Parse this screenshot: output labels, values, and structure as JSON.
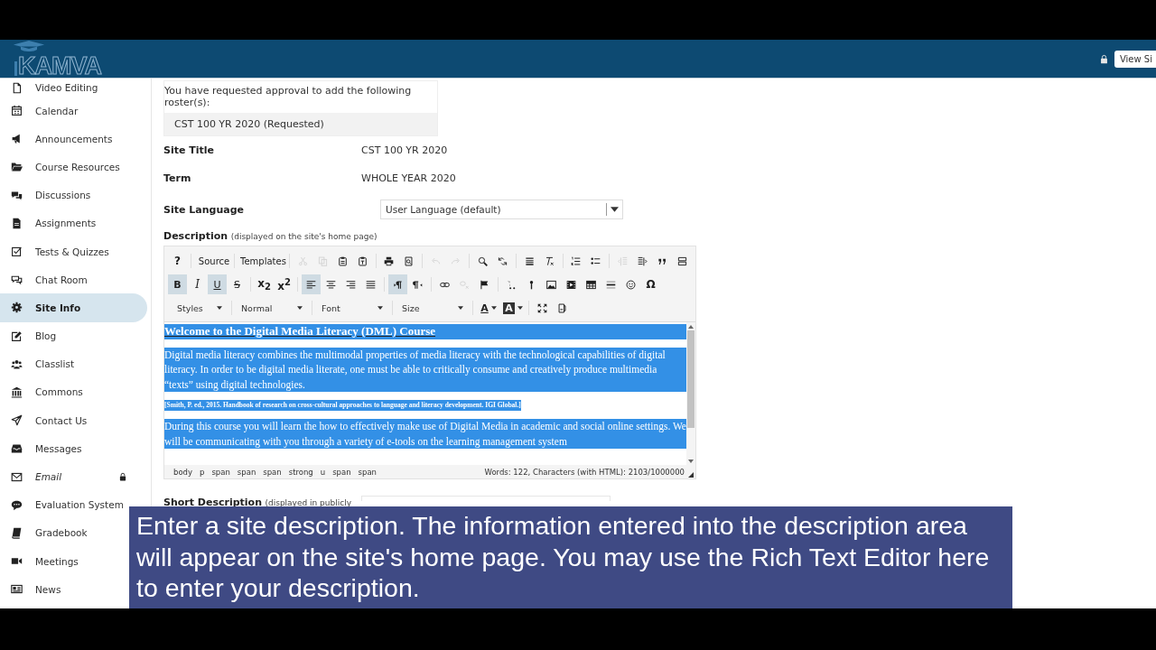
{
  "header": {
    "logo": "KAMVA",
    "view_site_button": "View Si"
  },
  "sidebar": {
    "items": [
      {
        "label": "Video Editing",
        "selected": false,
        "locked": false
      },
      {
        "label": "Calendar",
        "selected": false,
        "locked": false
      },
      {
        "label": "Announcements",
        "selected": false,
        "locked": false
      },
      {
        "label": "Course Resources",
        "selected": false,
        "locked": false
      },
      {
        "label": "Discussions",
        "selected": false,
        "locked": false
      },
      {
        "label": "Assignments",
        "selected": false,
        "locked": false
      },
      {
        "label": "Tests & Quizzes",
        "selected": false,
        "locked": false
      },
      {
        "label": "Chat Room",
        "selected": false,
        "locked": false
      },
      {
        "label": "Site Info",
        "selected": true,
        "locked": false
      },
      {
        "label": "Blog",
        "selected": false,
        "locked": false
      },
      {
        "label": "Classlist",
        "selected": false,
        "locked": false
      },
      {
        "label": "Commons",
        "selected": false,
        "locked": false
      },
      {
        "label": "Contact Us",
        "selected": false,
        "locked": false
      },
      {
        "label": "Messages",
        "selected": false,
        "locked": false
      },
      {
        "label": "Email",
        "selected": false,
        "locked": true
      },
      {
        "label": "Evaluation System",
        "selected": false,
        "locked": false
      },
      {
        "label": "Gradebook",
        "selected": false,
        "locked": false
      },
      {
        "label": "Meetings",
        "selected": false,
        "locked": false
      },
      {
        "label": "News",
        "selected": false,
        "locked": false
      }
    ]
  },
  "roster": {
    "message": "You have requested approval to add the following roster(s):",
    "items": [
      "CST 100 YR 2020 (Requested)"
    ]
  },
  "fields": [
    {
      "label": "Site Title",
      "value": "CST 100 YR 2020"
    },
    {
      "label": "Term",
      "value": "WHOLE YEAR 2020"
    }
  ],
  "site_language": {
    "label": "Site Language",
    "value": "User Language (default)"
  },
  "description": {
    "label": "Description",
    "hint": "(displayed on the site's home page)"
  },
  "editor": {
    "toolbar_rows": [
      [
        {
          "label": "?",
          "selected": false,
          "disabled": false
        },
        {
          "label": "Source",
          "selected": false,
          "disabled": false
        },
        {
          "label": "Templates",
          "selected": false,
          "disabled": false
        },
        {
          "selected": false,
          "disabled": true
        },
        {
          "selected": false,
          "disabled": true
        },
        {
          "selected": false,
          "disabled": false
        },
        {
          "selected": false,
          "disabled": false
        },
        {
          "selected": false,
          "disabled": false
        },
        {
          "selected": false,
          "disabled": false
        },
        {
          "selected": false,
          "disabled": true
        },
        {
          "selected": false,
          "disabled": true
        },
        {
          "selected": false,
          "disabled": false
        },
        {
          "selected": false,
          "disabled": false
        },
        {
          "selected": false,
          "disabled": false
        },
        {
          "selected": false,
          "disabled": false
        },
        {
          "selected": false,
          "disabled": false
        },
        {
          "selected": false,
          "disabled": false
        },
        {
          "selected": false,
          "disabled": true
        },
        {
          "selected": false,
          "disabled": false
        },
        {
          "selected": false,
          "disabled": false
        },
        {
          "selected": false,
          "disabled": false
        }
      ],
      [
        {
          "label": "B",
          "selected": true,
          "disabled": false
        },
        {
          "label": "I",
          "selected": false,
          "disabled": false
        },
        {
          "label": "U",
          "selected": true,
          "disabled": false
        },
        {
          "label": "S",
          "selected": false,
          "disabled": false
        },
        {
          "label": "x$_{2}$",
          "selected": false,
          "disabled": false
        },
        {
          "label": "x$^{2}$",
          "selected": false,
          "disabled": false
        },
        {
          "selected": true,
          "disabled": false
        },
        {
          "selected": false,
          "disabled": false
        },
        {
          "selected": false,
          "disabled": false
        },
        {
          "selected": false,
          "disabled": false
        },
        {
          "selected": true,
          "disabled": false
        },
        {
          "selected": false,
          "disabled": false
        },
        {
          "selected": false,
          "disabled": false
        },
        {
          "selected": false,
          "disabled": true
        },
        {
          "selected": false,
          "disabled": false
        },
        {
          "selected": false,
          "disabled": false
        },
        {
          "selected": false,
          "disabled": false
        },
        {
          "selected": false,
          "disabled": false
        },
        {
          "selected": false,
          "disabled": false
        },
        {
          "selected": false,
          "disabled": false
        },
        {
          "selected": false,
          "disabled": false
        },
        {
          "selected": false,
          "disabled": false
        },
        {
          "label": "Ω",
          "selected": false,
          "disabled": false
        }
      ]
    ],
    "combos": [
      "Styles",
      "Normal",
      "Font",
      "Size"
    ],
    "color_buttons": [
      "A",
      "A"
    ],
    "content": [
      {
        "kind": "heading",
        "text": "Welcome to the Digital Media Literacy (DML) Course",
        "selected": true
      },
      {
        "kind": "paragraph",
        "text": "Digital media literacy combines the multimodal properties of media literacy with the technological capabilities of digital literacy. In order to be digital media literate, one must be able to critically consume and creatively produce multimedia “texts” using digital technologies.",
        "selected": true
      },
      {
        "kind": "citation",
        "text": "[Smith, P. ed., 2015. Handbook of research on cross-cultural approaches to language and literacy development. IGI Global.]",
        "selected": true
      },
      {
        "kind": "paragraph",
        "text": "During this course you will learn the how to effectively make use of Digital Media in academic and social online settings.  We will be  communicating with you through a variety of e-tools on the learning management system",
        "selected": true
      }
    ],
    "element_path": [
      "body",
      "p",
      "span",
      "span",
      "span",
      "strong",
      "u",
      "span",
      "span"
    ],
    "word_count": "Words: 122, Characters (with HTML): 2103/1000000"
  },
  "short_description": {
    "label": "Short Description",
    "hint": "(displayed in publicly"
  },
  "caption": "Enter a site description. The information entered into the description area will appear on the site's home page. You may use the Rich Text Editor here to enter your description."
}
